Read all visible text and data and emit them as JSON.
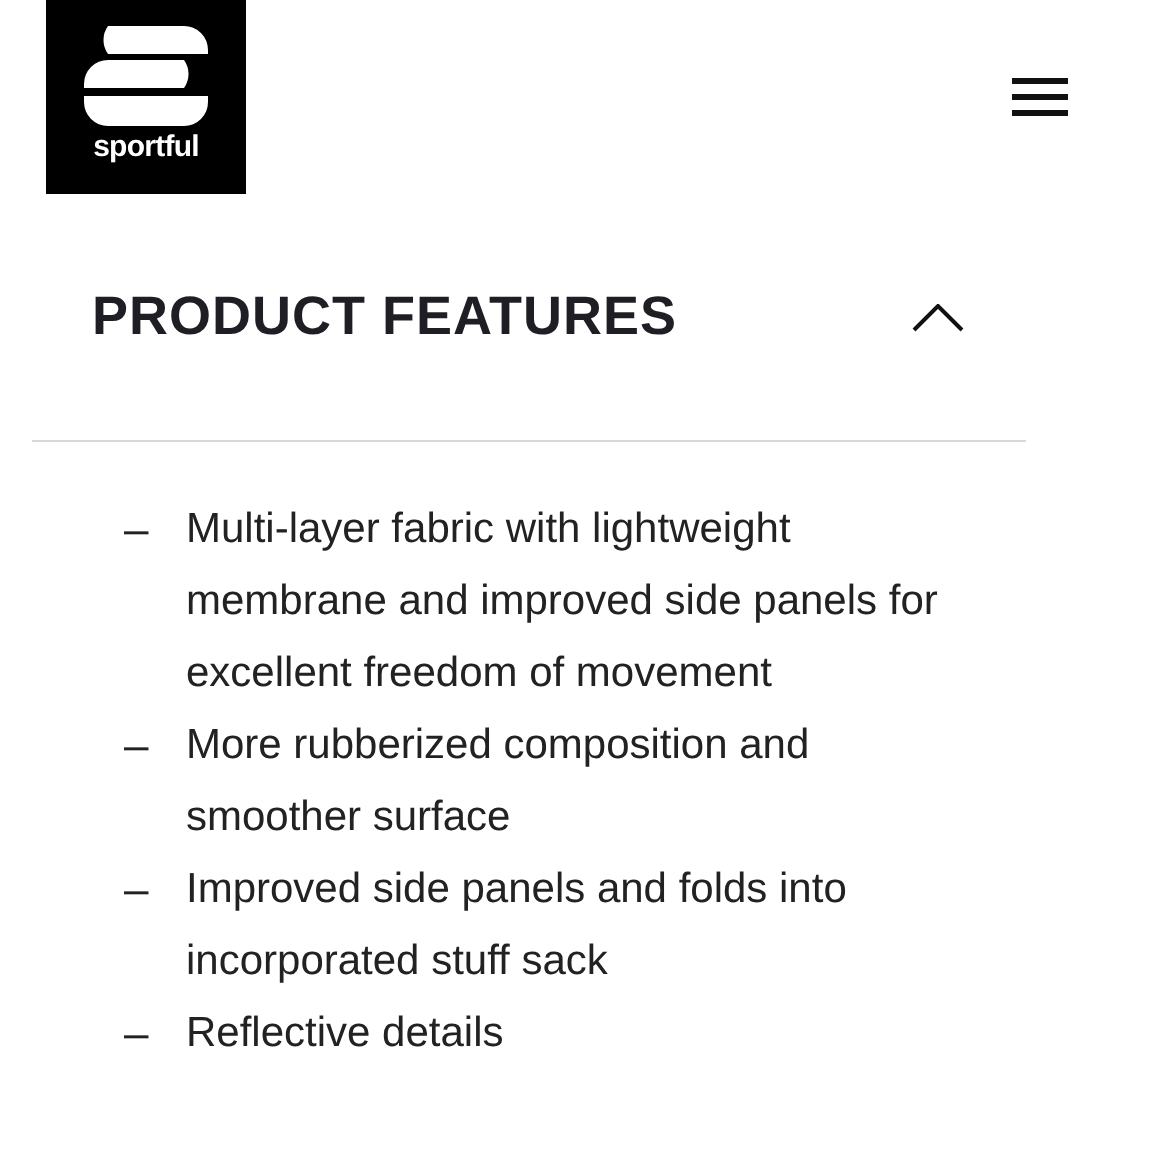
{
  "header": {
    "logo_text": "sportful"
  },
  "section": {
    "title": "PRODUCT FEATURES",
    "expanded": true,
    "items": [
      {
        "marker": "–",
        "text": "Multi-layer fabric with lightweight membrane and improved side panels for excellent freedom of movement"
      },
      {
        "marker": "–",
        "text": "More rubberized composition and smoother surface"
      },
      {
        "marker": "–",
        "text": "Improved side panels and folds into incorporated stuff sack"
      },
      {
        "marker": "–",
        "text": "Reflective details"
      }
    ]
  }
}
